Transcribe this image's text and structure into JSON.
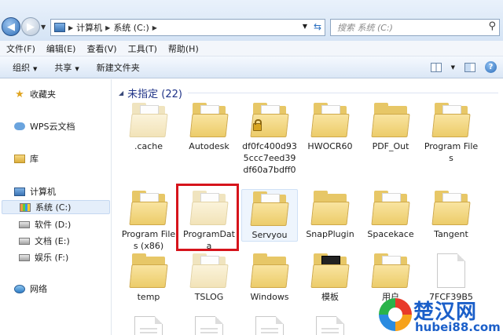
{
  "address": {
    "crumbs": [
      "计算机",
      "系统 (C:)"
    ],
    "search_placeholder": "搜索 系统 (C:)"
  },
  "menu": [
    "文件(F)",
    "编辑(E)",
    "查看(V)",
    "工具(T)",
    "帮助(H)"
  ],
  "toolbar": {
    "organize": "组织",
    "share": "共享",
    "new_folder": "新建文件夹"
  },
  "sidebar": {
    "favorites": "收藏夹",
    "wps_cloud": "WPS云文档",
    "libraries": "库",
    "computer": "计算机",
    "drives": [
      "系统 (C:)",
      "软件 (D:)",
      "文档 (E:)",
      "娱乐 (F:)"
    ],
    "network": "网络"
  },
  "group": {
    "title": "未指定 (22)"
  },
  "items": [
    ".cache",
    "Autodesk",
    "df0fc400d935ccc7eed39df60a7bdff0",
    "HWOCR60",
    "PDF_Out",
    "Program Files",
    "Program Files (x86)",
    "ProgramData",
    "Servyou",
    "SnapPlugin",
    "Spacekace",
    "Tangent",
    "temp",
    "TSLOG",
    "Windows",
    "模板",
    "用户",
    "7FCF39B5"
  ],
  "watermark": {
    "title": "楚汉网",
    "url": "hubei88.com"
  },
  "colors": {
    "highlight": "#d6141c",
    "group_header": "#1e3287",
    "watermark": "#1b5fc9"
  }
}
